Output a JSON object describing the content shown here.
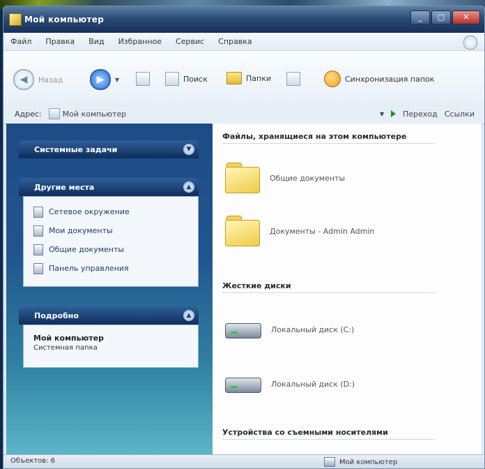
{
  "window": {
    "title": "Мой компьютер"
  },
  "menu": [
    "Файл",
    "Правка",
    "Вид",
    "Избранное",
    "Сервис",
    "Справка"
  ],
  "toolbar": {
    "back_label": "Назад",
    "search_label": "Поиск",
    "folders_label": "Папки",
    "sync_label": "Синхронизация папок"
  },
  "address": {
    "label": "Адрес:",
    "value": "Мой компьютер",
    "go_label": "Переход",
    "links_label": "Ссылки"
  },
  "sidebar": {
    "system_tasks": {
      "title": "Системные задачи"
    },
    "other_places": {
      "title": "Другие места",
      "links": [
        "Сетевое окружение",
        "Мои документы",
        "Общие документы",
        "Панель управления"
      ]
    },
    "details": {
      "title": "Подробно",
      "name": "Мой компьютер",
      "subtitle": "Системная папка"
    }
  },
  "content": {
    "stored_files_header": "Файлы, хранящиеся на этом компьютере",
    "folders": [
      "Общие документы",
      "Документы - Admin Admin"
    ],
    "hard_drives_header": "Жесткие диски",
    "drives": [
      "Локальный диск (C:)",
      "Локальный диск (D:)"
    ],
    "removable_header": "Устройства со съемными носителями"
  },
  "status": {
    "left": "Объектов: 6",
    "right": "Мой компьютер"
  }
}
